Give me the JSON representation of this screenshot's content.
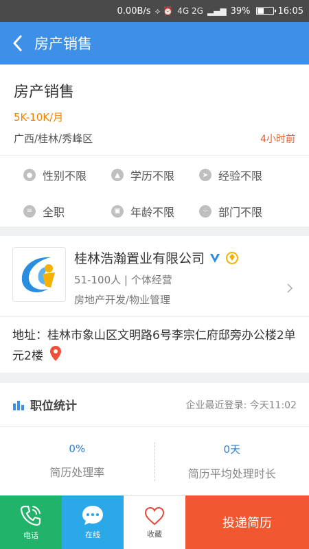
{
  "status_bar": {
    "speed": "0.00B/s",
    "network": "4G 2G",
    "battery": "39%",
    "time": "16:05",
    "battery_level": 0.39
  },
  "app_bar": {
    "title": "房产销售"
  },
  "job": {
    "title": "房产销售",
    "salary": "5K-10K/月",
    "location": "广西/桂林/秀峰区",
    "posted": "4小时前"
  },
  "requirements": [
    {
      "label": "性别不限",
      "icon": "gender-icon"
    },
    {
      "label": "学历不限",
      "icon": "education-icon"
    },
    {
      "label": "经验不限",
      "icon": "experience-icon"
    },
    {
      "label": "全职",
      "icon": "jobtype-icon"
    },
    {
      "label": "年龄不限",
      "icon": "age-icon"
    },
    {
      "label": "部门不限",
      "icon": "department-icon"
    }
  ],
  "company": {
    "name": "桂林浩瀚置业有限公司",
    "meta": "51-100人 | 个体经营",
    "industry": "房地产开发/物业管理"
  },
  "address": {
    "text": "地址：桂林市象山区文明路6号李宗仁府邸旁办公楼2单元2楼"
  },
  "stats": {
    "title": "职位统计",
    "last_login": "企业最近登录: 今天11:02",
    "items": [
      {
        "value": "0%",
        "label": "简历处理率"
      },
      {
        "value": "0天",
        "label": "简历平均处理时长"
      }
    ]
  },
  "bottom_bar": {
    "call": "电话",
    "chat": "在线",
    "favorite": "收藏",
    "apply": "投递简历"
  },
  "colors": {
    "primary": "#3d8fe8",
    "salary": "#f08300",
    "call": "#21b36a",
    "chat": "#2aa8e8",
    "apply": "#f2582f"
  }
}
